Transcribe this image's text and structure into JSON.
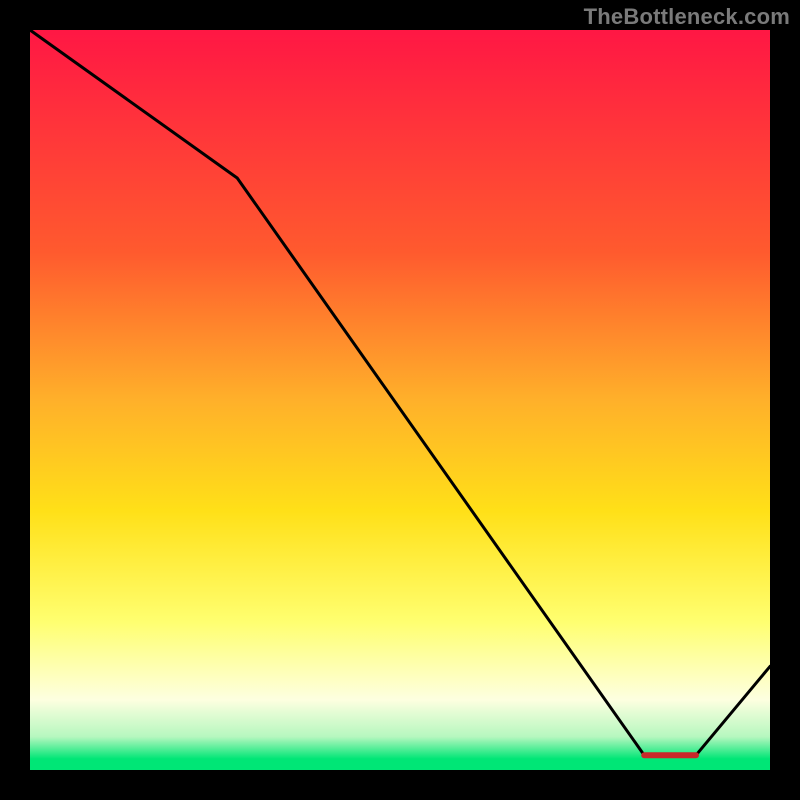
{
  "watermark": "TheBottleneck.com",
  "annotation_label": "",
  "colors": {
    "top": "#ff1744",
    "mid_upper": "#ff8a2a",
    "mid": "#ffd818",
    "lower_yellow": "#ffff70",
    "pale_band": "#fdffe0",
    "green": "#00e676",
    "line": "#000000"
  },
  "chart_data": {
    "type": "line",
    "title": "",
    "xlabel": "",
    "ylabel": "",
    "xlim": [
      0,
      100
    ],
    "ylim": [
      0,
      100
    ],
    "x": [
      0,
      28,
      83,
      90,
      100
    ],
    "values": [
      100,
      80,
      2,
      2,
      14
    ],
    "gradient_stops": [
      {
        "offset": 0.0,
        "color": "#ff1744"
      },
      {
        "offset": 0.3,
        "color": "#ff5a2e"
      },
      {
        "offset": 0.5,
        "color": "#ffb02a"
      },
      {
        "offset": 0.65,
        "color": "#ffe018"
      },
      {
        "offset": 0.8,
        "color": "#ffff70"
      },
      {
        "offset": 0.905,
        "color": "#fdffe0"
      },
      {
        "offset": 0.955,
        "color": "#b6f7bf"
      },
      {
        "offset": 0.985,
        "color": "#00e676"
      }
    ],
    "annotation": {
      "text": "",
      "x_range": [
        83,
        90
      ],
      "y": 2
    }
  }
}
